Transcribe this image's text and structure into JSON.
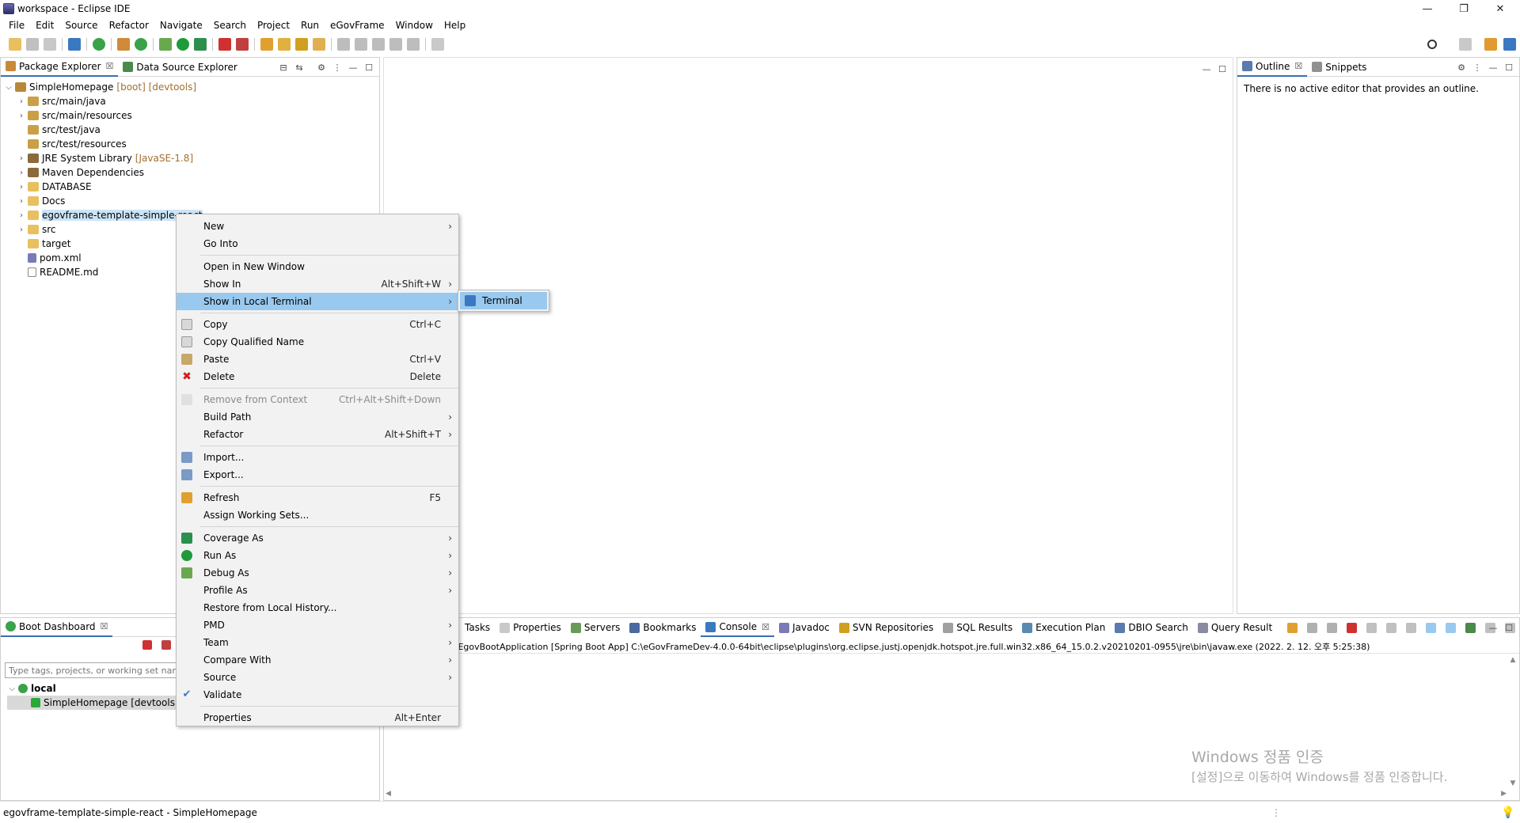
{
  "window": {
    "title": "workspace - Eclipse IDE",
    "minimize": "—",
    "restore": "❐",
    "close": "✕"
  },
  "menubar": [
    "File",
    "Edit",
    "Source",
    "Refactor",
    "Navigate",
    "Search",
    "Project",
    "Run",
    "eGovFrame",
    "Window",
    "Help"
  ],
  "left_pane": {
    "tabs": [
      {
        "label": "Package Explorer",
        "icon": "package-explorer-icon"
      },
      {
        "label": "Data Source Explorer",
        "icon": "data-source-icon"
      }
    ],
    "tab_close": "☒",
    "tree": [
      {
        "label": "SimpleHomepage",
        "deco": "[boot] [devtools]",
        "level": 0,
        "expanded": true,
        "icon": "project-icon"
      },
      {
        "label": "src/main/java",
        "level": 1,
        "icon": "source-folder-icon"
      },
      {
        "label": "src/main/resources",
        "level": 1,
        "icon": "source-folder-icon"
      },
      {
        "label": "src/test/java",
        "level": 1,
        "icon": "source-folder-icon"
      },
      {
        "label": "src/test/resources",
        "level": 1,
        "icon": "source-folder-icon"
      },
      {
        "label": "JRE System Library",
        "deco": "[JavaSE-1.8]",
        "level": 1,
        "icon": "library-icon"
      },
      {
        "label": "Maven Dependencies",
        "level": 1,
        "icon": "library-icon"
      },
      {
        "label": "DATABASE",
        "level": 1,
        "icon": "folder-icon"
      },
      {
        "label": "Docs",
        "level": 1,
        "icon": "folder-icon"
      },
      {
        "label": "egovframe-template-simple-react",
        "level": 1,
        "icon": "folder-icon",
        "selected": true
      },
      {
        "label": "src",
        "level": 1,
        "icon": "folder-icon"
      },
      {
        "label": "target",
        "level": 1,
        "icon": "folder-icon"
      },
      {
        "label": "pom.xml",
        "level": 1,
        "icon": "xml-file-icon"
      },
      {
        "label": "README.md",
        "level": 1,
        "icon": "markdown-file-icon"
      }
    ]
  },
  "outline_pane": {
    "tabs": [
      {
        "label": "Outline",
        "icon": "outline-icon"
      },
      {
        "label": "Snippets",
        "icon": "snippets-icon"
      }
    ],
    "message": "There is no active editor that provides an outline."
  },
  "boot_dashboard": {
    "tab": "Boot Dashboard",
    "filter_placeholder": "Type tags, projects, or working set names",
    "tree": [
      {
        "label": "local",
        "level": 0
      },
      {
        "label": "SimpleHomepage [devtools]",
        "level": 1
      }
    ]
  },
  "bottom_pane": {
    "tabs": [
      "Tasks",
      "Properties",
      "Servers",
      "Bookmarks",
      "Console",
      "Javadoc",
      "SVN Repositories",
      "SQL Results",
      "Execution Plan",
      "DBIO Search",
      "Query Result"
    ],
    "console_line": "- EgovBootApplication [Spring Boot App] C:\\eGovFrameDev-4.0.0-64bit\\eclipse\\plugins\\org.eclipse.justj.openjdk.hotspot.jre.full.win32.x86_64_15.0.2.v20210201-0955\\jre\\bin\\javaw.exe  (2022. 2. 12. 오후 5:25:38)"
  },
  "context_menu": [
    {
      "label": "New",
      "submenu": true
    },
    {
      "label": "Go Into"
    },
    {
      "sep": true
    },
    {
      "label": "Open in New Window"
    },
    {
      "label": "Show In",
      "accel": "Alt+Shift+W",
      "submenu": true
    },
    {
      "label": "Show in Local Terminal",
      "submenu": true,
      "highlighted": true
    },
    {
      "sep": true
    },
    {
      "label": "Copy",
      "accel": "Ctrl+C",
      "icon": "copy-icon"
    },
    {
      "label": "Copy Qualified Name",
      "icon": "copy-qualified-icon"
    },
    {
      "label": "Paste",
      "accel": "Ctrl+V",
      "icon": "paste-icon"
    },
    {
      "label": "Delete",
      "accel": "Delete",
      "icon": "delete-icon"
    },
    {
      "sep": true
    },
    {
      "label": "Remove from Context",
      "accel": "Ctrl+Alt+Shift+Down",
      "disabled": true,
      "icon": "remove-context-icon"
    },
    {
      "label": "Build Path",
      "submenu": true
    },
    {
      "label": "Refactor",
      "accel": "Alt+Shift+T",
      "submenu": true
    },
    {
      "sep": true
    },
    {
      "label": "Import...",
      "icon": "import-icon"
    },
    {
      "label": "Export...",
      "icon": "export-icon"
    },
    {
      "sep": true
    },
    {
      "label": "Refresh",
      "accel": "F5",
      "icon": "refresh-icon"
    },
    {
      "label": "Assign Working Sets..."
    },
    {
      "sep": true
    },
    {
      "label": "Coverage As",
      "submenu": true,
      "icon": "coverage-icon"
    },
    {
      "label": "Run As",
      "submenu": true,
      "icon": "run-icon"
    },
    {
      "label": "Debug As",
      "submenu": true,
      "icon": "debug-icon"
    },
    {
      "label": "Profile As",
      "submenu": true
    },
    {
      "label": "Restore from Local History..."
    },
    {
      "label": "PMD",
      "submenu": true
    },
    {
      "label": "Team",
      "submenu": true
    },
    {
      "label": "Compare With",
      "submenu": true
    },
    {
      "label": "Source",
      "submenu": true
    },
    {
      "label": "Validate",
      "icon": "check-icon"
    },
    {
      "sep": true
    },
    {
      "label": "Properties",
      "accel": "Alt+Enter"
    }
  ],
  "submenu": {
    "label": "Terminal",
    "icon": "terminal-icon"
  },
  "statusbar": {
    "text": "egovframe-template-simple-react - SimpleHomepage"
  },
  "watermark": {
    "line1": "Windows 정품 인증",
    "line2": "[설정]으로 이동하여 Windows를 정품 인증합니다."
  },
  "colors": {
    "selection": "#cce4f7",
    "menu_highlight": "#99c9ef",
    "menu_bg": "#f2f2f2",
    "decoration": "#a07030"
  }
}
